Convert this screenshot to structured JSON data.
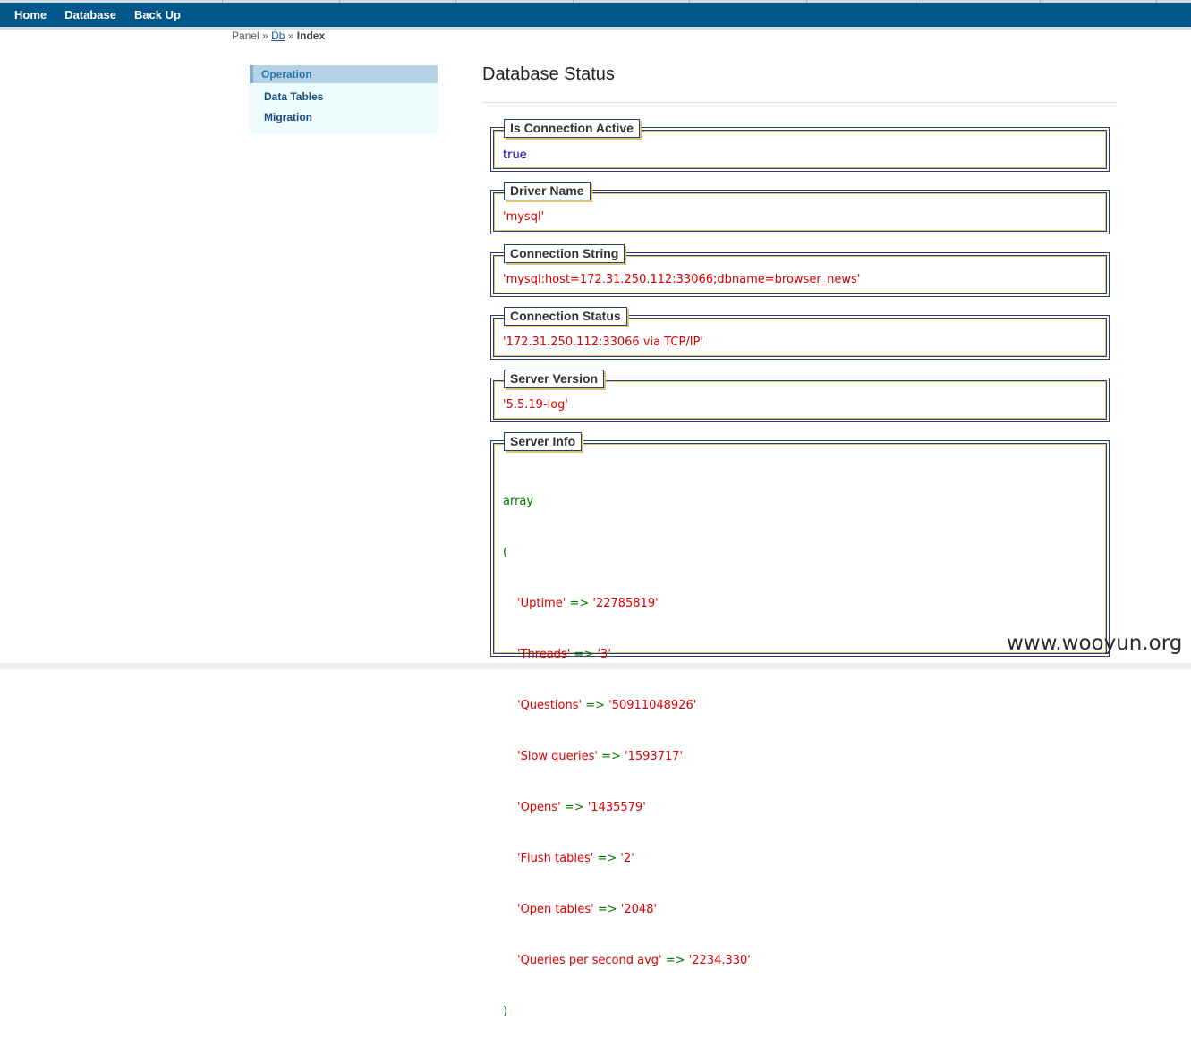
{
  "nav": {
    "items": [
      "Home",
      "Database",
      "Back Up"
    ]
  },
  "breadcrumb": {
    "panel": "Panel",
    "sep1": "»",
    "db": "Db",
    "sep2": "»",
    "current": "Index"
  },
  "sidebar": {
    "header": "Operation",
    "items": [
      "Data Tables",
      "Migration"
    ]
  },
  "page": {
    "title": "Database Status"
  },
  "sections": [
    {
      "legend": "Is Connection Active",
      "value": "true"
    },
    {
      "legend": "Driver Name",
      "value": "'mysql'"
    },
    {
      "legend": "Connection String",
      "value": "'mysql:host=172.31.250.112:33066;dbname=browser_news'"
    },
    {
      "legend": "Connection Status",
      "value": "'172.31.250.112:33066 via TCP/IP'"
    },
    {
      "legend": "Server Version",
      "value": "'5.5.19-log'"
    }
  ],
  "server_info": {
    "legend": "Server Info",
    "open": "array",
    "paren_open": "(",
    "arrow": "=>",
    "entries": [
      {
        "key": "'Uptime'",
        "value": "'22785819'"
      },
      {
        "key": "'Threads'",
        "value": "'3'"
      },
      {
        "key": "'Questions'",
        "value": "'50911048926'"
      },
      {
        "key": "'Slow queries'",
        "value": "'1593717'"
      },
      {
        "key": "'Opens'",
        "value": "'1435579'"
      },
      {
        "key": "'Flush tables'",
        "value": "'2'"
      },
      {
        "key": "'Open tables'",
        "value": "'2048'"
      },
      {
        "key": "'Queries per second avg'",
        "value": "'2234.330'"
      }
    ],
    "paren_close": ")"
  },
  "watermark": "www.wooyun.org"
}
